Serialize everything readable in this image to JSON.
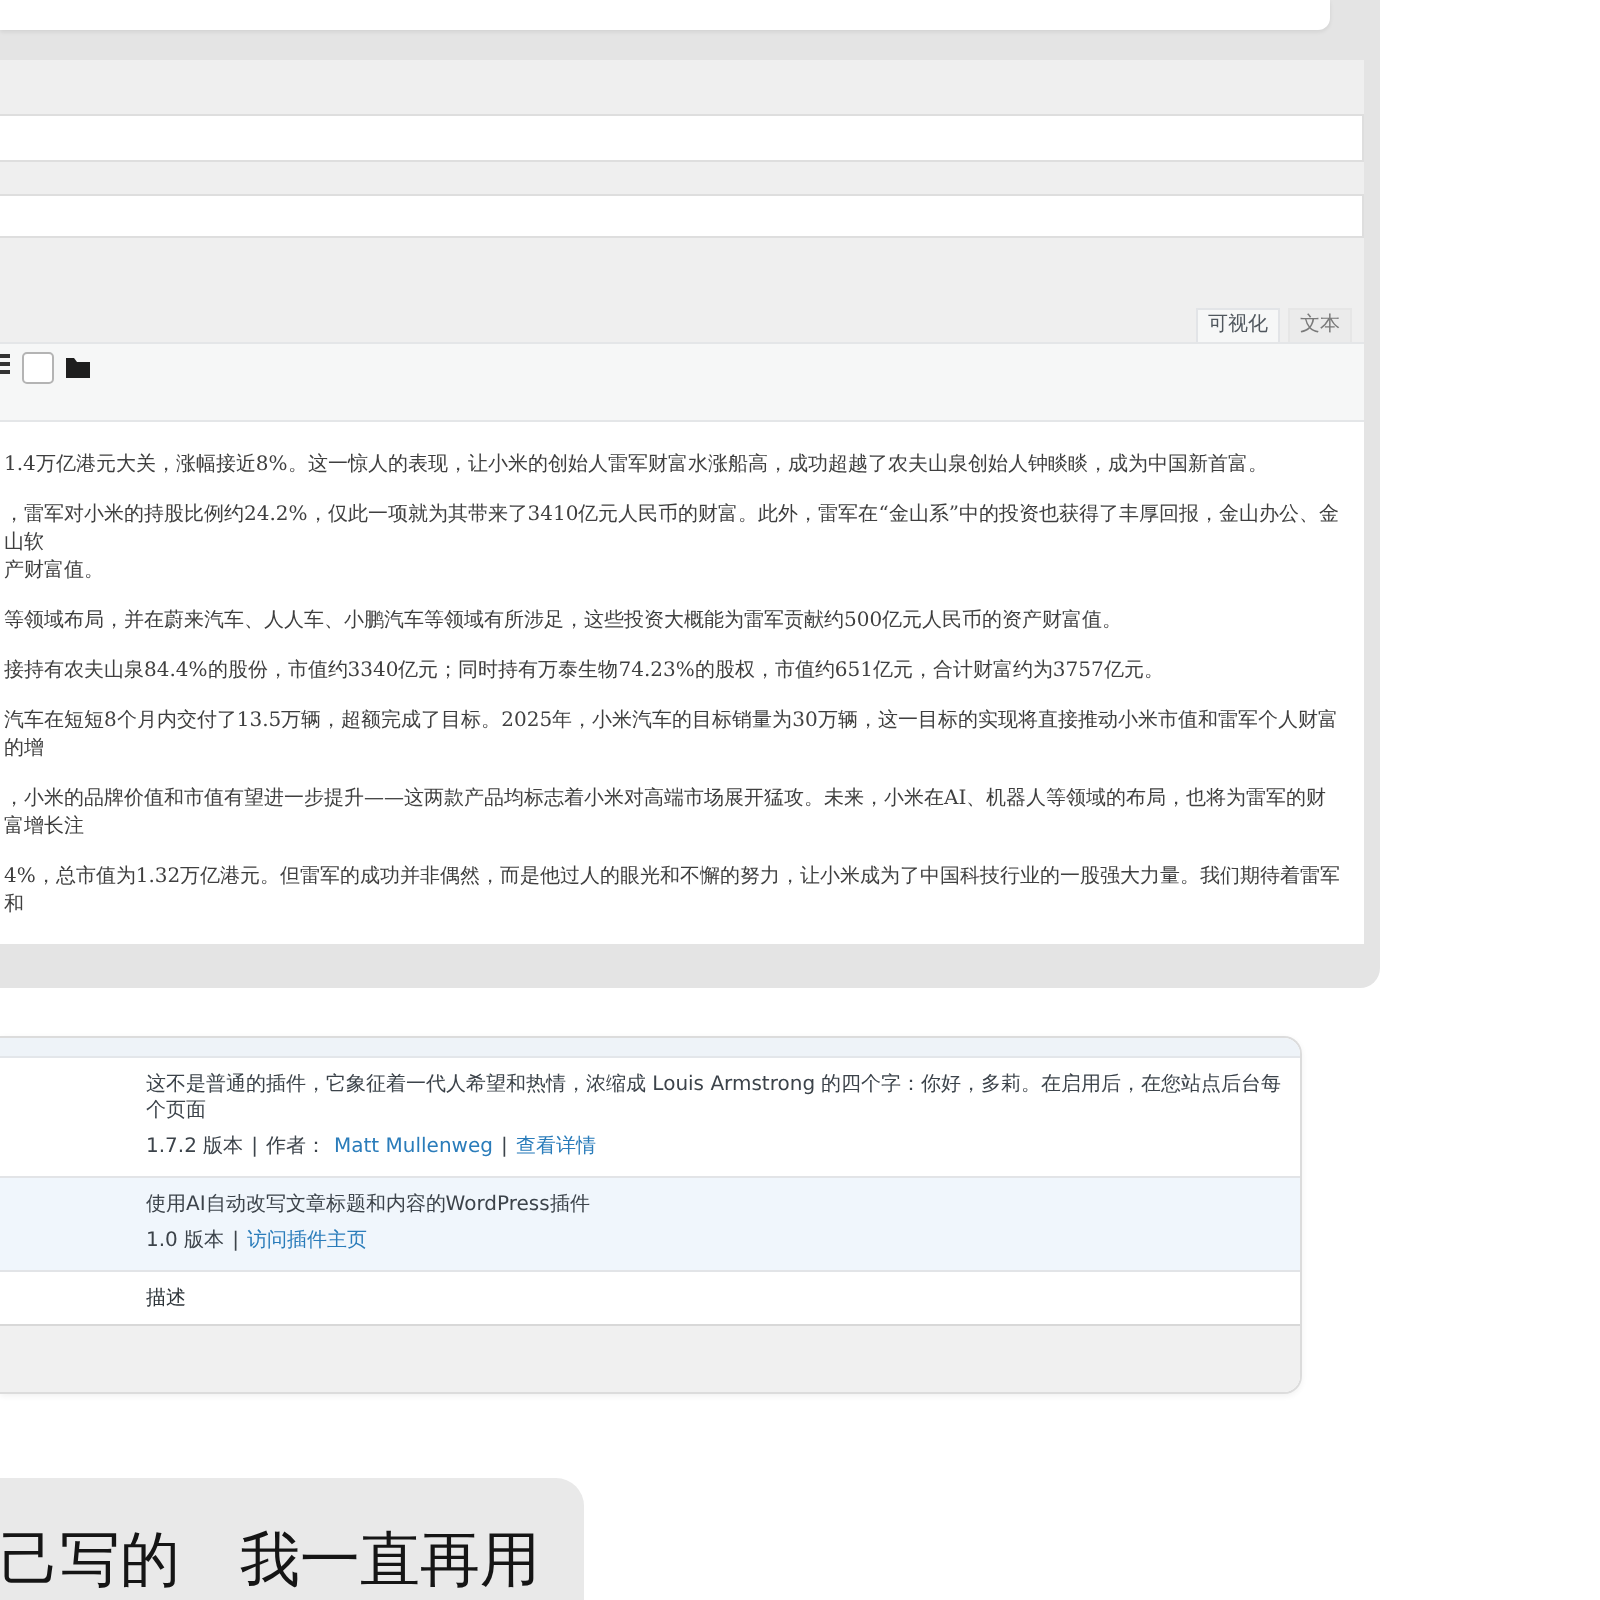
{
  "editor": {
    "tabs": [
      {
        "label": "可视化",
        "selected": true
      },
      {
        "label": "文本",
        "selected": false
      }
    ],
    "paragraphs": [
      {
        "lines": [
          "1.4万亿港元大关，涨幅接近8%。这一惊人的表现，让小米的创始人雷军财富水涨船高，成功超越了农夫山泉创始人钟睒睒，成为中国新首富。"
        ]
      },
      {
        "lines": [
          "，雷军对小米的持股比例约24.2%，仅此一项就为其带来了3410亿元人民币的财富。此外，雷军在“金山系”中的投资也获得了丰厚回报，金山办公、金山软",
          "产财富值。"
        ]
      },
      {
        "lines": [
          "等领域布局，并在蔚来汽车、人人车、小鹏汽车等领域有所涉足，这些投资大概能为雷军贡献约500亿元人民币的资产财富值。"
        ]
      },
      {
        "lines": [
          "接持有农夫山泉84.4%的股份，市值约3340亿元；同时持有万泰生物74.23%的股权，市值约651亿元，合计财富约为3757亿元。"
        ]
      },
      {
        "lines": [
          "汽车在短短8个月内交付了13.5万辆，超额完成了目标。2025年，小米汽车的目标销量为30万辆，这一目标的实现将直接推动小米市值和雷军个人财富的增"
        ]
      },
      {
        "lines": [
          "，小米的品牌价值和市值有望进一步提升——这两款产品均标志着小米对高端市场展开猛攻。未来，小米在AI、机器人等领域的布局，也将为雷军的财富增长注"
        ]
      },
      {
        "lines": [
          "4%，总市值为1.32万亿港元。但雷军的成功并非偶然，而是他过人的眼光和不懈的努力，让小米成为了中国科技行业的一股强大力量。我们期待着雷军和"
        ]
      }
    ]
  },
  "plugins": {
    "rows": [
      {
        "active": false,
        "description": "这不是普通的插件，它象征着一代人希望和热情，浓缩成 Louis Armstrong 的四个字：你好，多莉。在启用后，在您站点后台每个页面",
        "meta": [
          {
            "kind": "text",
            "text": "1.7.2 版本"
          },
          {
            "kind": "separator",
            "text": "|"
          },
          {
            "kind": "text",
            "text": "作者："
          },
          {
            "kind": "link",
            "text": "Matt Mullenweg"
          },
          {
            "kind": "separator",
            "text": "|"
          },
          {
            "kind": "link",
            "text": "查看详情"
          }
        ]
      },
      {
        "active": true,
        "description": "使用AI自动改写文章标题和内容的WordPress插件",
        "meta": [
          {
            "kind": "text",
            "text": "1.0 版本"
          },
          {
            "kind": "separator",
            "text": "|"
          },
          {
            "kind": "link",
            "text": "访问插件主页"
          }
        ]
      }
    ],
    "footer_column": "描述"
  },
  "message": {
    "text": "己写的　我一直再用"
  }
}
